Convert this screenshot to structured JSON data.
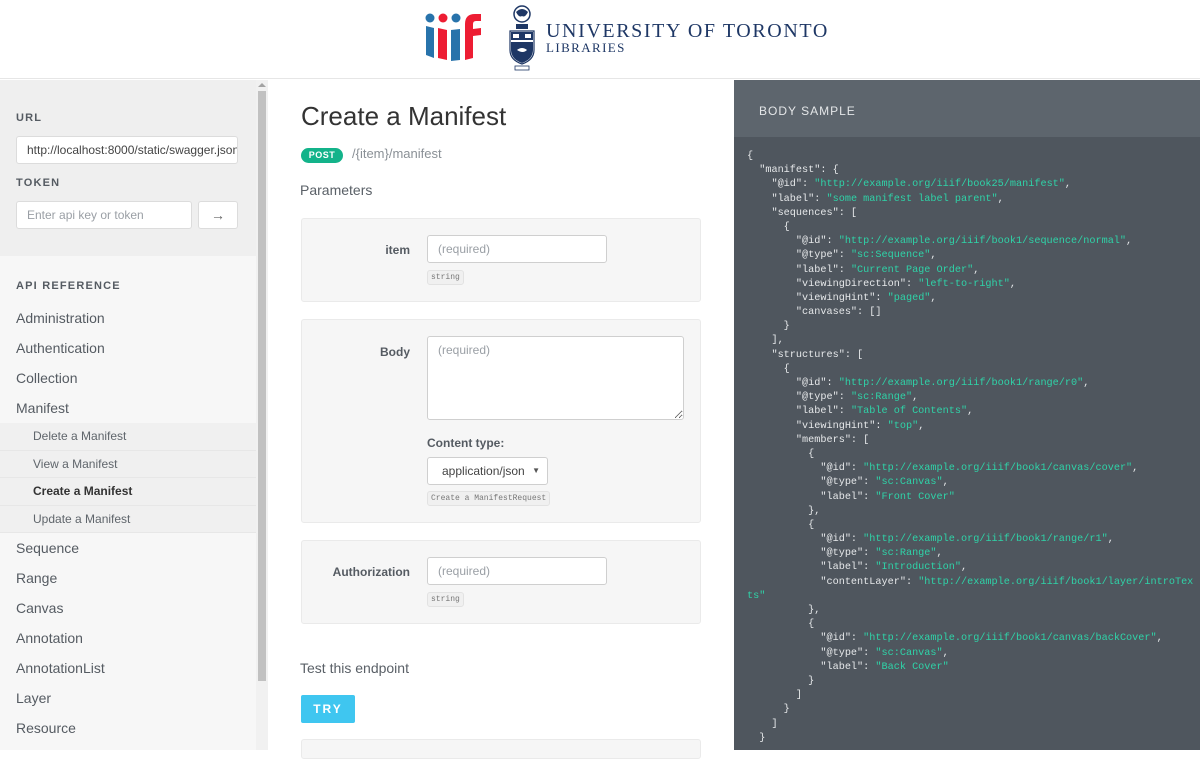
{
  "header": {
    "logo_iiif_alt": "iiif",
    "institution_name": "UNIVERSITY OF TORONTO",
    "institution_sub": "LIBRARIES"
  },
  "sidebar": {
    "url_label": "URL",
    "url_value": "http://localhost:8000/static/swagger.json",
    "token_label": "TOKEN",
    "token_placeholder": "Enter api key or token",
    "token_submit_icon": "arrow-right-icon",
    "token_submit_glyph": "→",
    "api_reference_label": "API REFERENCE",
    "nav_before": [
      "Administration",
      "Authentication",
      "Collection",
      "Manifest"
    ],
    "manifest_subitems": [
      "Delete a Manifest",
      "View a Manifest",
      "Create a Manifest",
      "Update a Manifest"
    ],
    "active_subitem": "Create a Manifest",
    "nav_after": [
      "Sequence",
      "Range",
      "Canvas",
      "Annotation",
      "AnnotationList",
      "Layer",
      "Resource"
    ]
  },
  "main": {
    "title": "Create a Manifest",
    "method": "POST",
    "path": "/{item}/manifest",
    "parameters_title": "Parameters",
    "params": {
      "item": {
        "label": "item",
        "placeholder": "(required)",
        "type": "string"
      },
      "body": {
        "label": "Body",
        "placeholder": "(required)",
        "content_type_label": "Content type:",
        "content_type_value": "application/json",
        "schema": "Create a ManifestRequest"
      },
      "authorization": {
        "label": "Authorization",
        "placeholder": "(required)",
        "type": "string"
      }
    },
    "test_title": "Test this endpoint",
    "try_label": "TRY"
  },
  "code_panel": {
    "title": "BODY SAMPLE",
    "lines": [
      [
        [
          "",
          "{"
        ]
      ],
      [
        [
          "",
          "  \"manifest\": {"
        ]
      ],
      [
        [
          "",
          "    \"@id\": "
        ],
        [
          "s",
          "\"http://example.org/iiif/book25/manifest\""
        ],
        [
          "",
          ","
        ]
      ],
      [
        [
          "",
          "    \"label\": "
        ],
        [
          "s",
          "\"some manifest label parent\""
        ],
        [
          "",
          ","
        ]
      ],
      [
        [
          "",
          "    \"sequences\": ["
        ]
      ],
      [
        [
          "",
          "      {"
        ]
      ],
      [
        [
          "",
          "        \"@id\": "
        ],
        [
          "s",
          "\"http://example.org/iiif/book1/sequence/normal\""
        ],
        [
          "",
          ","
        ]
      ],
      [
        [
          "",
          "        \"@type\": "
        ],
        [
          "s",
          "\"sc:Sequence\""
        ],
        [
          "",
          ","
        ]
      ],
      [
        [
          "",
          "        \"label\": "
        ],
        [
          "s",
          "\"Current Page Order\""
        ],
        [
          "",
          ","
        ]
      ],
      [
        [
          "",
          "        \"viewingDirection\": "
        ],
        [
          "s",
          "\"left-to-right\""
        ],
        [
          "",
          ","
        ]
      ],
      [
        [
          "",
          "        \"viewingHint\": "
        ],
        [
          "s",
          "\"paged\""
        ],
        [
          "",
          ","
        ]
      ],
      [
        [
          "",
          "        \"canvases\": []"
        ]
      ],
      [
        [
          "",
          "      }"
        ]
      ],
      [
        [
          "",
          "    ],"
        ]
      ],
      [
        [
          "",
          "    \"structures\": ["
        ]
      ],
      [
        [
          "",
          "      {"
        ]
      ],
      [
        [
          "",
          "        \"@id\": "
        ],
        [
          "s",
          "\"http://example.org/iiif/book1/range/r0\""
        ],
        [
          "",
          ","
        ]
      ],
      [
        [
          "",
          "        \"@type\": "
        ],
        [
          "s",
          "\"sc:Range\""
        ],
        [
          "",
          ","
        ]
      ],
      [
        [
          "",
          "        \"label\": "
        ],
        [
          "s",
          "\"Table of Contents\""
        ],
        [
          "",
          ","
        ]
      ],
      [
        [
          "",
          "        \"viewingHint\": "
        ],
        [
          "s",
          "\"top\""
        ],
        [
          "",
          ","
        ]
      ],
      [
        [
          "",
          "        \"members\": ["
        ]
      ],
      [
        [
          "",
          "          {"
        ]
      ],
      [
        [
          "",
          "            \"@id\": "
        ],
        [
          "s",
          "\"http://example.org/iiif/book1/canvas/cover\""
        ],
        [
          "",
          ","
        ]
      ],
      [
        [
          "",
          "            \"@type\": "
        ],
        [
          "s",
          "\"sc:Canvas\""
        ],
        [
          "",
          ","
        ]
      ],
      [
        [
          "",
          "            \"label\": "
        ],
        [
          "s",
          "\"Front Cover\""
        ]
      ],
      [
        [
          "",
          "          },"
        ]
      ],
      [
        [
          "",
          "          {"
        ]
      ],
      [
        [
          "",
          "            \"@id\": "
        ],
        [
          "s",
          "\"http://example.org/iiif/book1/range/r1\""
        ],
        [
          "",
          ","
        ]
      ],
      [
        [
          "",
          "            \"@type\": "
        ],
        [
          "s",
          "\"sc:Range\""
        ],
        [
          "",
          ","
        ]
      ],
      [
        [
          "",
          "            \"label\": "
        ],
        [
          "s",
          "\"Introduction\""
        ],
        [
          "",
          ","
        ]
      ],
      [
        [
          "",
          "            \"contentLayer\": "
        ],
        [
          "s",
          "\"http://example.org/iiif/book1/layer/introTex"
        ]
      ],
      [
        [
          "s",
          "ts\""
        ]
      ],
      [
        [
          "",
          "          },"
        ]
      ],
      [
        [
          "",
          "          {"
        ]
      ],
      [
        [
          "",
          "            \"@id\": "
        ],
        [
          "s",
          "\"http://example.org/iiif/book1/canvas/backCover\""
        ],
        [
          "",
          ","
        ]
      ],
      [
        [
          "",
          "            \"@type\": "
        ],
        [
          "s",
          "\"sc:Canvas\""
        ],
        [
          "",
          ","
        ]
      ],
      [
        [
          "",
          "            \"label\": "
        ],
        [
          "s",
          "\"Back Cover\""
        ]
      ],
      [
        [
          "",
          "          }"
        ]
      ],
      [
        [
          "",
          "        ]"
        ]
      ],
      [
        [
          "",
          "      }"
        ]
      ],
      [
        [
          "",
          "    ]"
        ]
      ],
      [
        [
          "",
          "  }"
        ]
      ]
    ]
  },
  "colors": {
    "post_badge": "#13b38a",
    "try_button": "#3fc6f0",
    "code_string": "#2fd3a8",
    "code_bg": "#4f565e",
    "code_header_bg": "#5d656d",
    "uoft_blue": "#1e3765"
  }
}
